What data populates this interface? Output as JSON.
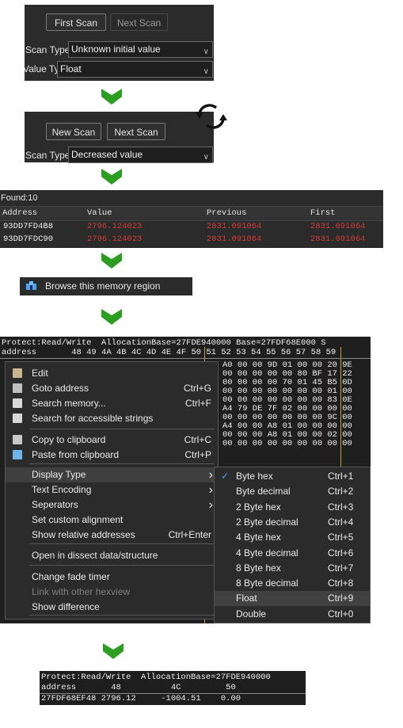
{
  "colors": {
    "arrow": "#2e9e23",
    "red": "#d43a3a",
    "dark_bg": "#2b2b2b",
    "check": "#4aa3ff"
  },
  "scan1": {
    "first_scan": "First Scan",
    "next_scan": "Next Scan",
    "scan_type_label": "Scan Type",
    "scan_type_value": "Unknown initial value",
    "value_type_label": "Value Type",
    "value_type_value": "Float"
  },
  "scan2": {
    "new_scan": "New Scan",
    "next_scan": "Next Scan",
    "scan_type_label": "Scan Type",
    "scan_type_value": "Decreased value",
    "refresh_icon": "refresh-icon"
  },
  "results": {
    "found": "Found:10",
    "headers": [
      "Address",
      "Value",
      "Previous",
      "First"
    ],
    "rows": [
      [
        "93DD7FD4B8",
        "2796.124023",
        "2831.091064",
        "2831.091064"
      ],
      [
        "93DD7FDC90",
        "2796.124023",
        "2831.091064",
        "2831.091064"
      ]
    ]
  },
  "browse": {
    "label": "Browse this memory region",
    "icon": "binoculars-icon"
  },
  "hexview": {
    "header1": "Protect:Read/Write  AllocationBase=27FDE940000 Base=27FDF68E000 S",
    "header2": "address       48 49 4A 4B 4C 4D 4E 4F 50 51 52 53 54 55 56 57 58 59",
    "rows": [
      "A0 00 00 9D 01 00 00 20 9E",
      "00 00 00 00 00 80 BF 17 22",
      "00 00 00 00 70 01 45 B5 0D",
      "00 00 00 00 00 00 00 01 00",
      "00 00 00 00 00 00 00 83 0E",
      "A4 79 DE 7F 02 00 00 00 00",
      "00 00 00 00 00 00 00 9C 00",
      "A4 00 00 A8 01 00 00 00 00",
      "00 00 00 A8 01 00 00 02 00",
      "00 00 00 00 00 00 00 00 00"
    ]
  },
  "context_menu": {
    "items": [
      {
        "label": "Edit",
        "shortcut": "",
        "icon": "edit-icon"
      },
      {
        "label": "Goto address",
        "shortcut": "Ctrl+G",
        "icon": "goto-icon"
      },
      {
        "label": "Search memory...",
        "shortcut": "Ctrl+F",
        "icon": "search-icon"
      },
      {
        "label": "Search for accessible strings",
        "shortcut": "",
        "icon": "search-strings-icon"
      },
      {
        "label": "Copy to clipboard",
        "shortcut": "Ctrl+C",
        "icon": "copy-icon"
      },
      {
        "label": "Paste from clipboard",
        "shortcut": "Ctrl+P",
        "icon": "paste-icon"
      },
      {
        "label": "Display Type",
        "shortcut": "",
        "submenu": true
      },
      {
        "label": "Text Encoding",
        "shortcut": "",
        "submenu": true
      },
      {
        "label": "Seperators",
        "shortcut": "",
        "submenu": true
      },
      {
        "label": "Set custom alignment",
        "shortcut": ""
      },
      {
        "label": "Show relative addresses",
        "shortcut": "Ctrl+Enter"
      },
      {
        "label": "Open in dissect data/structure",
        "shortcut": ""
      },
      {
        "label": "Change fade timer",
        "shortcut": ""
      },
      {
        "label": "Link with other hexview",
        "shortcut": "",
        "disabled": true
      },
      {
        "label": "Show difference",
        "shortcut": ""
      }
    ]
  },
  "display_submenu": {
    "items": [
      {
        "label": "Byte hex",
        "shortcut": "Ctrl+1",
        "checked": true
      },
      {
        "label": "Byte decimal",
        "shortcut": "Ctrl+2"
      },
      {
        "label": "2 Byte hex",
        "shortcut": "Ctrl+3"
      },
      {
        "label": "2 Byte decimal",
        "shortcut": "Ctrl+4"
      },
      {
        "label": "4 Byte hex",
        "shortcut": "Ctrl+5"
      },
      {
        "label": "4 Byte decimal",
        "shortcut": "Ctrl+6"
      },
      {
        "label": "8 Byte hex",
        "shortcut": "Ctrl+7"
      },
      {
        "label": "8 Byte decimal",
        "shortcut": "Ctrl+8"
      },
      {
        "label": "Float",
        "shortcut": "Ctrl+9",
        "highlighted": true
      },
      {
        "label": "Double",
        "shortcut": "Ctrl+0"
      }
    ]
  },
  "final_view": {
    "header1": "Protect:Read/Write  AllocationBase=27FDE940000",
    "header2": "address       48          4C         50",
    "row": "27FDF68EF48 2796.12     -1004.51    0.00"
  }
}
